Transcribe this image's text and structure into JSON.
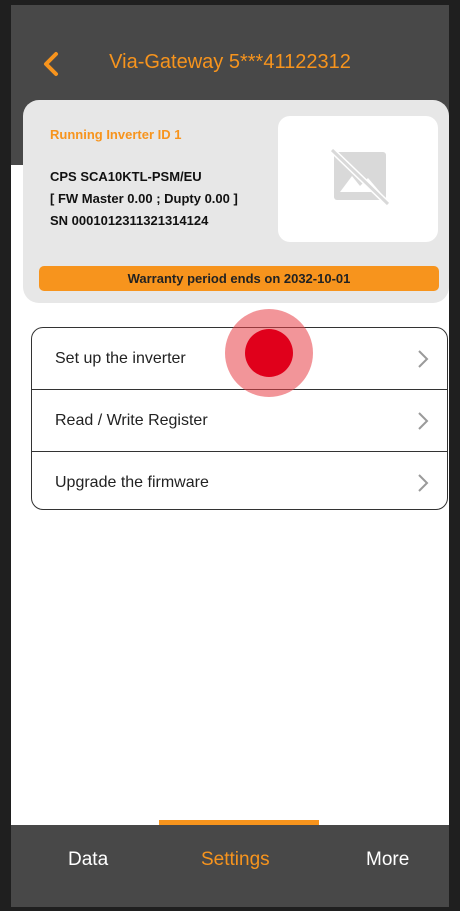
{
  "header": {
    "title": "Via-Gateway 5***41122312",
    "back_icon": "chevron-left-icon"
  },
  "inverter_card": {
    "label": "Running Inverter ID 1",
    "model": "CPS SCA10KTL-PSM/EU",
    "firmware": "[ FW Master 0.00 ; Dupty 0.00 ]",
    "serial": "SN 0001012311321314124",
    "image_icon": "no-image-icon",
    "warranty": "Warranty period ends on 2032-10-01"
  },
  "menu": {
    "items": [
      {
        "label": "Set up the inverter"
      },
      {
        "label": "Read / Write Register"
      },
      {
        "label": "Upgrade the firmware"
      }
    ],
    "chevron_icon": "chevron-right-icon"
  },
  "tabs": [
    {
      "label": "Data"
    },
    {
      "label": "Settings",
      "active": true
    },
    {
      "label": "More"
    }
  ],
  "colors": {
    "accent": "#f7941d",
    "header_bg": "#484848",
    "card_bg": "#e7e7e7",
    "touch_indicator": "#e0001b"
  }
}
